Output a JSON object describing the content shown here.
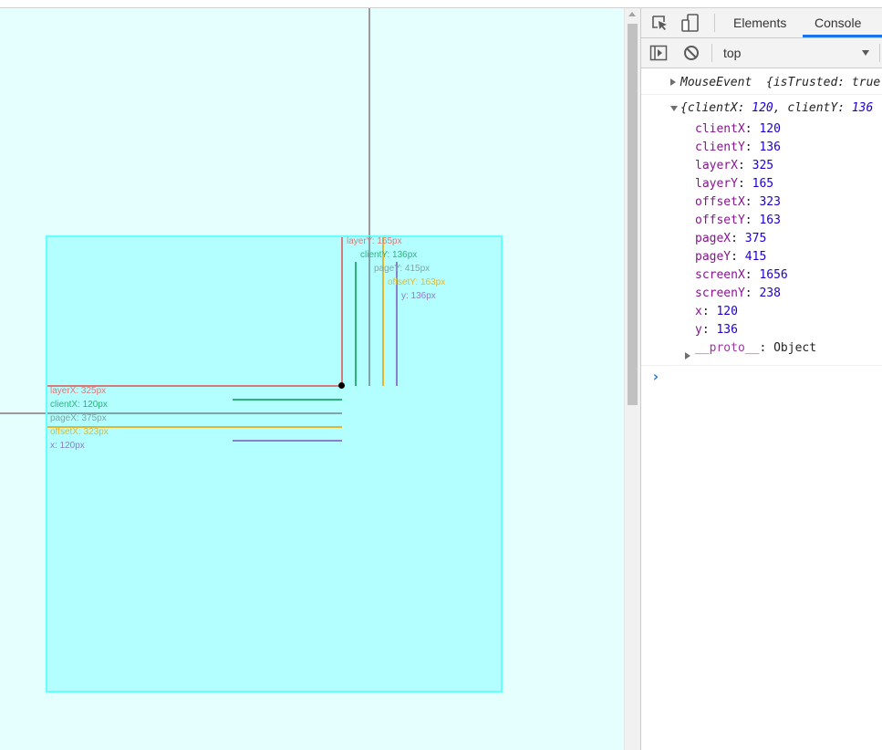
{
  "colors": {
    "viewport_bg": "#e5ffff",
    "box_fill": "#b3ffff",
    "box_border": "#66ffff",
    "layer": "#d97a7a",
    "client": "#2db37a",
    "page": "#7fa6a6",
    "offset": "#e0b830",
    "xy": "#8a7fc8",
    "guide": "#9a9a9a",
    "accent": "#1a73e8"
  },
  "annotations": {
    "layerX": "layerX: 325px",
    "clientX": "clientX: 120px",
    "pageX": "pageX: 375px",
    "offsetX": "offsetX: 323px",
    "x": "x: 120px",
    "layerY": "layerY: 165px",
    "clientY": "clientY: 136px",
    "pageY": "pageY: 415px",
    "offsetY": "offsetY: 163px",
    "y": "y: 136px"
  },
  "devtools": {
    "tabs": {
      "elements": "Elements",
      "console": "Console"
    },
    "icons": [
      "inspect-element-icon",
      "device-toggle-icon",
      "sidebar-toggle-icon",
      "clear-console-icon",
      "dropdown-arrow-icon"
    ],
    "context": "top",
    "console": {
      "line1": {
        "name": "MouseEvent",
        "rest": "{isTrusted: true"
      },
      "line2": {
        "prefix": "{clientX: ",
        "v1": "120",
        "mid": ", clientY: ",
        "v2": "136"
      },
      "props": [
        {
          "key": "clientX",
          "value": "120"
        },
        {
          "key": "clientY",
          "value": "136"
        },
        {
          "key": "layerX",
          "value": "325"
        },
        {
          "key": "layerY",
          "value": "165"
        },
        {
          "key": "offsetX",
          "value": "323"
        },
        {
          "key": "offsetY",
          "value": "163"
        },
        {
          "key": "pageX",
          "value": "375"
        },
        {
          "key": "pageY",
          "value": "415"
        },
        {
          "key": "screenX",
          "value": "1656"
        },
        {
          "key": "screenY",
          "value": "238"
        },
        {
          "key": "x",
          "value": "120"
        },
        {
          "key": "y",
          "value": "136"
        }
      ],
      "proto": {
        "key": "__proto__",
        "value": "Object"
      },
      "prompt": "›"
    }
  }
}
